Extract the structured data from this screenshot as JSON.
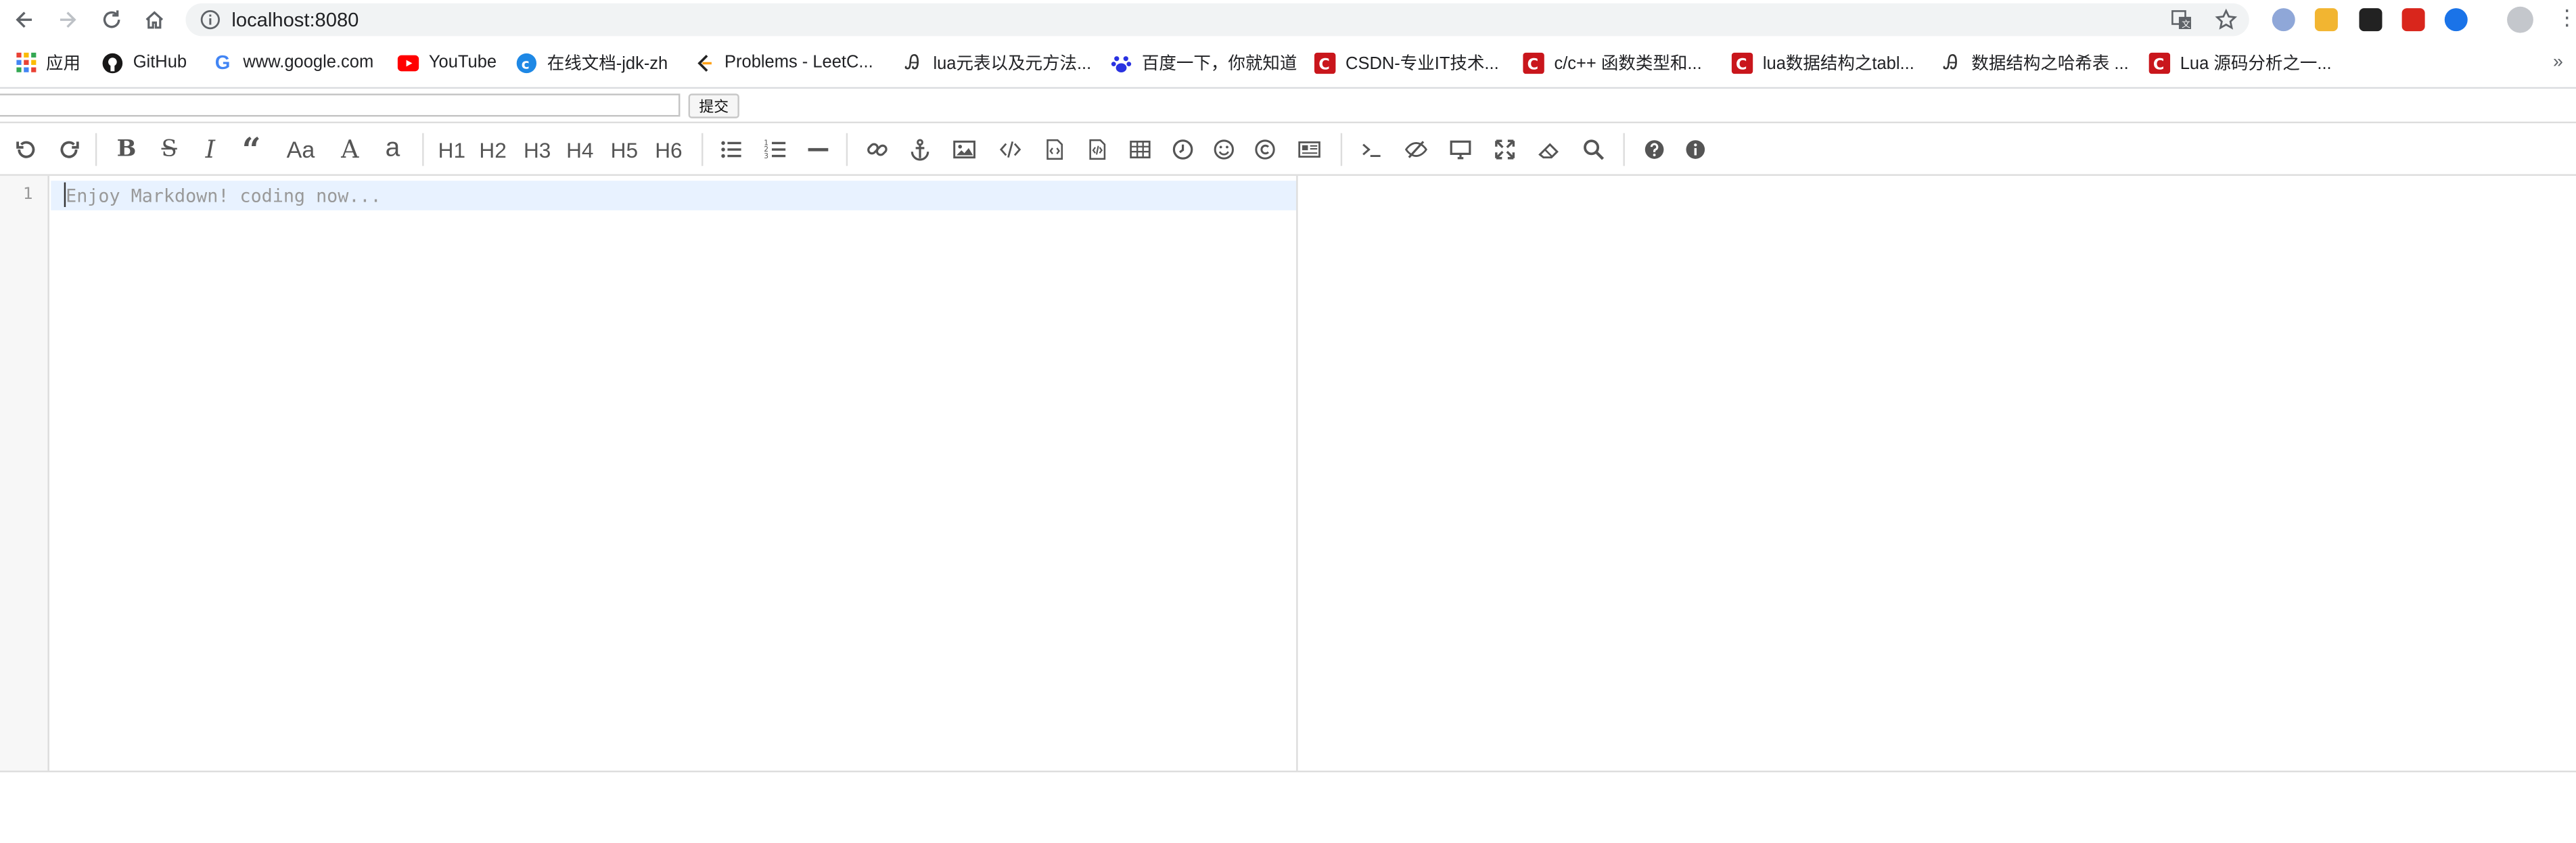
{
  "browser": {
    "url": "localhost:8080"
  },
  "bookmarks": [
    {
      "label": "应用",
      "icon": "apps-grid-icon"
    },
    {
      "label": "GitHub",
      "icon": "github-icon"
    },
    {
      "label": "www.google.com",
      "icon": "google-icon"
    },
    {
      "label": "YouTube",
      "icon": "youtube-icon"
    },
    {
      "label": "在线文档-jdk-zh",
      "icon": "doc-site-icon"
    },
    {
      "label": "Problems - LeetC...",
      "icon": "leetcode-icon"
    },
    {
      "label": "lua元表以及元方法...",
      "icon": "jianshu-icon"
    },
    {
      "label": "百度一下，你就知道",
      "icon": "baidu-icon"
    },
    {
      "label": "CSDN-专业IT技术...",
      "icon": "csdn-icon"
    },
    {
      "label": "c/c++ 函数类型和...",
      "icon": "csdn-icon"
    },
    {
      "label": "lua数据结构之tabl...",
      "icon": "csdn-icon"
    },
    {
      "label": "数据结构之哈希表 ...",
      "icon": "jianshu-icon"
    },
    {
      "label": "Lua 源码分析之一...",
      "icon": "csdn-icon"
    }
  ],
  "form": {
    "input_value": "",
    "submit_label": "提交"
  },
  "toolbar": {
    "heading_labels": [
      "H1",
      "H2",
      "H3",
      "H4",
      "H5",
      "H6"
    ],
    "case_label": "Aa",
    "upper_a": "A",
    "lower_a": "a"
  },
  "editor": {
    "line_number": "1",
    "placeholder": "Enjoy Markdown! coding now..."
  },
  "colors": {
    "accent": "#1a73e8",
    "csdn_red": "#c9161c",
    "youtube_red": "#ff0000",
    "active_line": "#e8f2ff"
  }
}
